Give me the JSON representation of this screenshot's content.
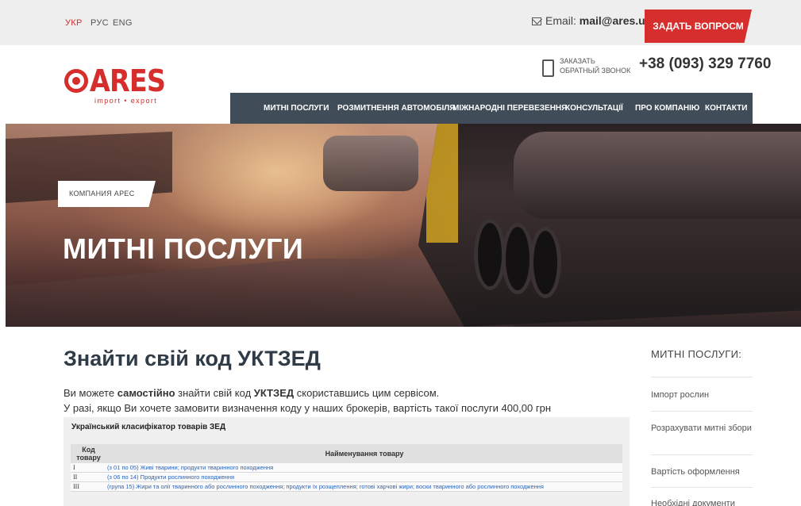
{
  "topbar": {
    "languages": [
      {
        "label": "УКР",
        "active": true
      },
      {
        "label": "РУС",
        "active": false
      },
      {
        "label": "ENG",
        "active": false
      }
    ],
    "email_label": "Email:",
    "email_value": "mail@ares.ua",
    "ask_button": "ЗАДАТЬ ВОПРОСМ"
  },
  "logo": {
    "name": "ARES",
    "tagline": "import • export"
  },
  "header": {
    "callback_label": "ЗАКАЗАТЬ ОБРАТНЫЙ ЗВОНОК",
    "phone": "+38 (093) 329 7760"
  },
  "nav": {
    "items": [
      "МИТНІ ПОСЛУГИ",
      "РОЗМИТНЕННЯ АВТОМОБІЛЯ",
      "МІЖНАРОДНІ ПЕРЕВЕЗЕННЯ",
      "КОНСУЛЬТАЦІЇ",
      "ПРО КОМПАНІЮ",
      "КОНТАКТИ"
    ]
  },
  "hero": {
    "breadcrumb": "КОМПАНИЯ АРЕС",
    "title": "МИТНІ ПОСЛУГИ"
  },
  "content": {
    "title": "Знайти свій код УКТЗЕД",
    "intro1_pre": "Ви можете ",
    "intro1_bold1": "самостійно",
    "intro1_mid": " знайти свій код ",
    "intro1_bold2": "УКТЗЕД",
    "intro1_post": " скориставшись цим сервісом.",
    "intro2": "У разі, якщо Ви хочете замовити визначення коду у наших брокерів, вартість такої послуги 400,00 грн"
  },
  "classifier": {
    "title": "Український класифікатор товарів ЗЕД",
    "col_code": "Код товару",
    "col_name": "Найменування товару",
    "rows": [
      {
        "code": "I",
        "name": "(з 01 по 05) Живі тварини; продукти тваринного походження"
      },
      {
        "code": "II",
        "name": "(з 06 по 14) Продукти рослинного походження"
      },
      {
        "code": "III",
        "name": "(група 15) Жири та олії тваринного або рослинного походження; продукти їх розщеплення; готові харчові жири; воски тваринного або рослинного походження"
      }
    ]
  },
  "sidebar": {
    "title": "МИТНІ ПОСЛУГИ:",
    "items": [
      "Імпорт рослин",
      "Розрахувати митні збори",
      "Вартість оформлення",
      "Необхідні документи"
    ]
  },
  "colors": {
    "accent": "#d62d2d",
    "nav_bg": "#404d59",
    "link": "#2a63b8"
  }
}
